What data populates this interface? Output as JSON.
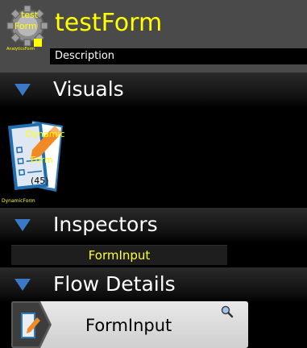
{
  "header": {
    "app_icon_text_top": "test",
    "app_icon_text_mid": "Form",
    "app_icon_caption": "AnalyticsForm",
    "title": "testForm",
    "description_label": "Description"
  },
  "sections": {
    "visuals": "Visuals",
    "inspectors": "Inspectors",
    "flow_details": "Flow Details"
  },
  "visuals": {
    "item_title_top": "Dynamic",
    "item_title_mid": "Form",
    "item_count": "(45)",
    "item_caption": "DynamicForm"
  },
  "inspectors": {
    "items": [
      "FormInput"
    ]
  },
  "flow_details": {
    "items": [
      "FormInput"
    ]
  },
  "colors": {
    "accent_yellow": "#ffff00",
    "header_bg": "#4a4a4a",
    "triangle_blue": "#3a78c8"
  }
}
